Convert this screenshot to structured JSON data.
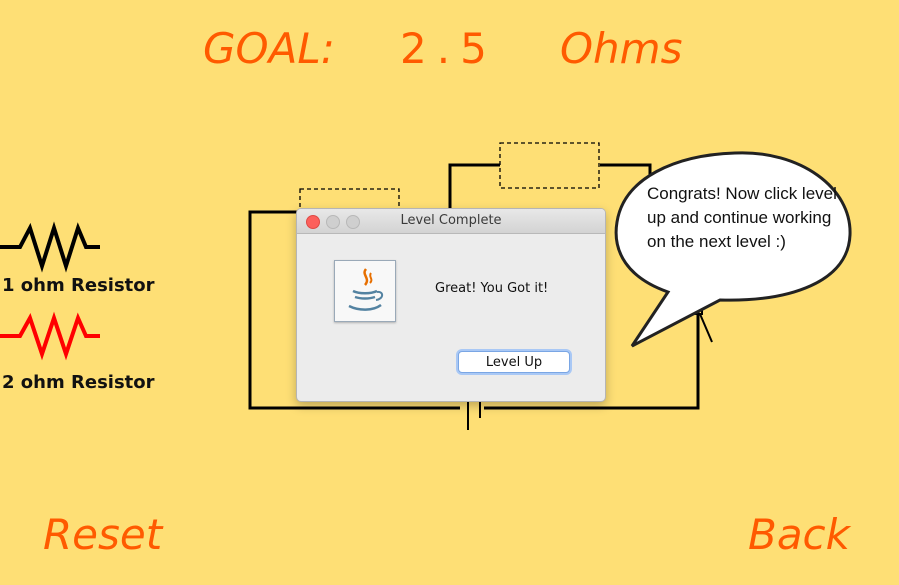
{
  "goal": {
    "label": "GOAL:",
    "value": "2.5",
    "unit": "Ohms"
  },
  "palette": {
    "resistor1_label": "1 ohm Resistor",
    "resistor2_label": "2 ohm Resistor"
  },
  "dialog": {
    "title": "Level Complete",
    "message": "Great! You Got it!",
    "button_label": "Level Up"
  },
  "speech_bubble": {
    "text": "Congrats! Now click level up and continue working on the next level :)"
  },
  "nav": {
    "reset_label": "Reset",
    "back_label": "Back"
  },
  "colors": {
    "background": "#fedf75",
    "accent": "#ff5a00",
    "resistor1": "#000000",
    "resistor2": "#ff0000"
  },
  "icons": {
    "dialog_icon": "java-coffee-cup-icon"
  }
}
